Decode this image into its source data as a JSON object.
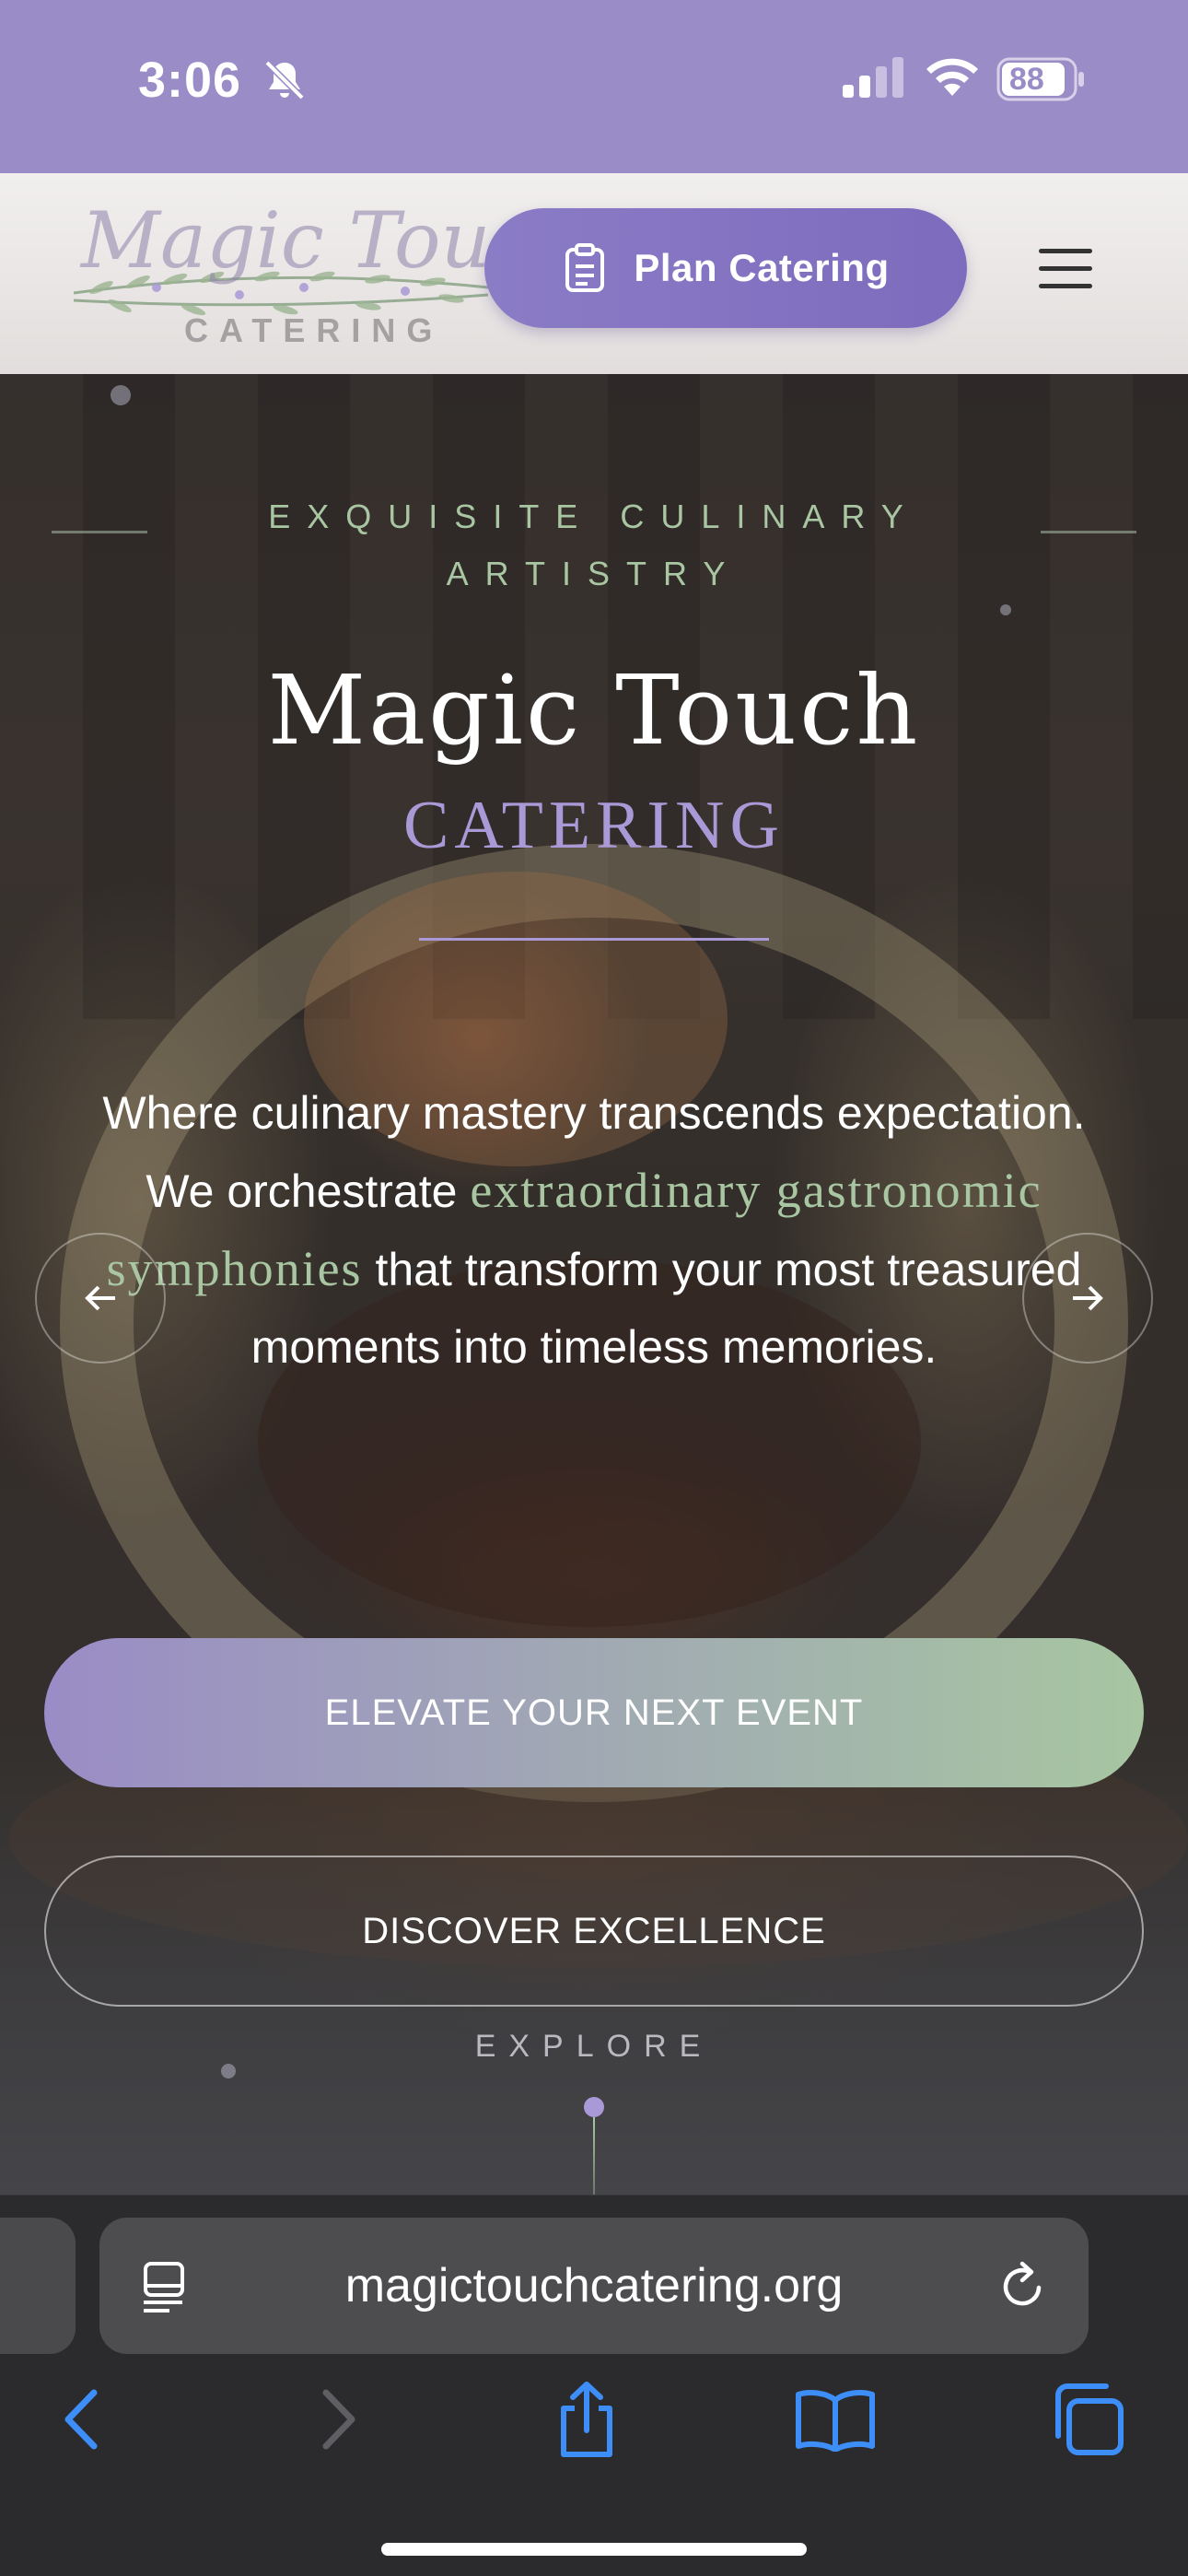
{
  "status_bar": {
    "time": "3:06",
    "battery_level": "88"
  },
  "header": {
    "logo_text": "Magic Touch",
    "logo_subtext": "CATERING",
    "plan_button_label": "Plan Catering"
  },
  "hero": {
    "kicker": "EXQUISITE CULINARY ARTISTRY",
    "title": "Magic Touch",
    "subtitle": "CATERING",
    "description_before": "Where culinary mastery transcends expectation. We orchestrate ",
    "description_highlight": "extraordinary gastronomic symphonies",
    "description_after": " that transform your most treasured moments into timeless memories.",
    "primary_cta": "ELEVATE YOUR NEXT EVENT",
    "secondary_cta": "DISCOVER EXCELLENCE",
    "explore_label": "EXPLORE"
  },
  "browser": {
    "url": "magictouchcatering.org"
  },
  "colors": {
    "status_bar": "#9a8cc6",
    "accent_purple": "#a999d6",
    "accent_green": "#a9c6a2",
    "ios_blue": "#3d8ef8"
  },
  "icons": [
    "bell-slash-icon",
    "signal-icon",
    "wifi-icon",
    "battery-icon",
    "clipboard-icon",
    "hamburger-menu-icon",
    "arrow-left-icon",
    "arrow-right-icon",
    "reader-page-icon",
    "reload-icon",
    "back-icon",
    "forward-icon",
    "share-icon",
    "bookmarks-icon",
    "tabs-icon"
  ]
}
